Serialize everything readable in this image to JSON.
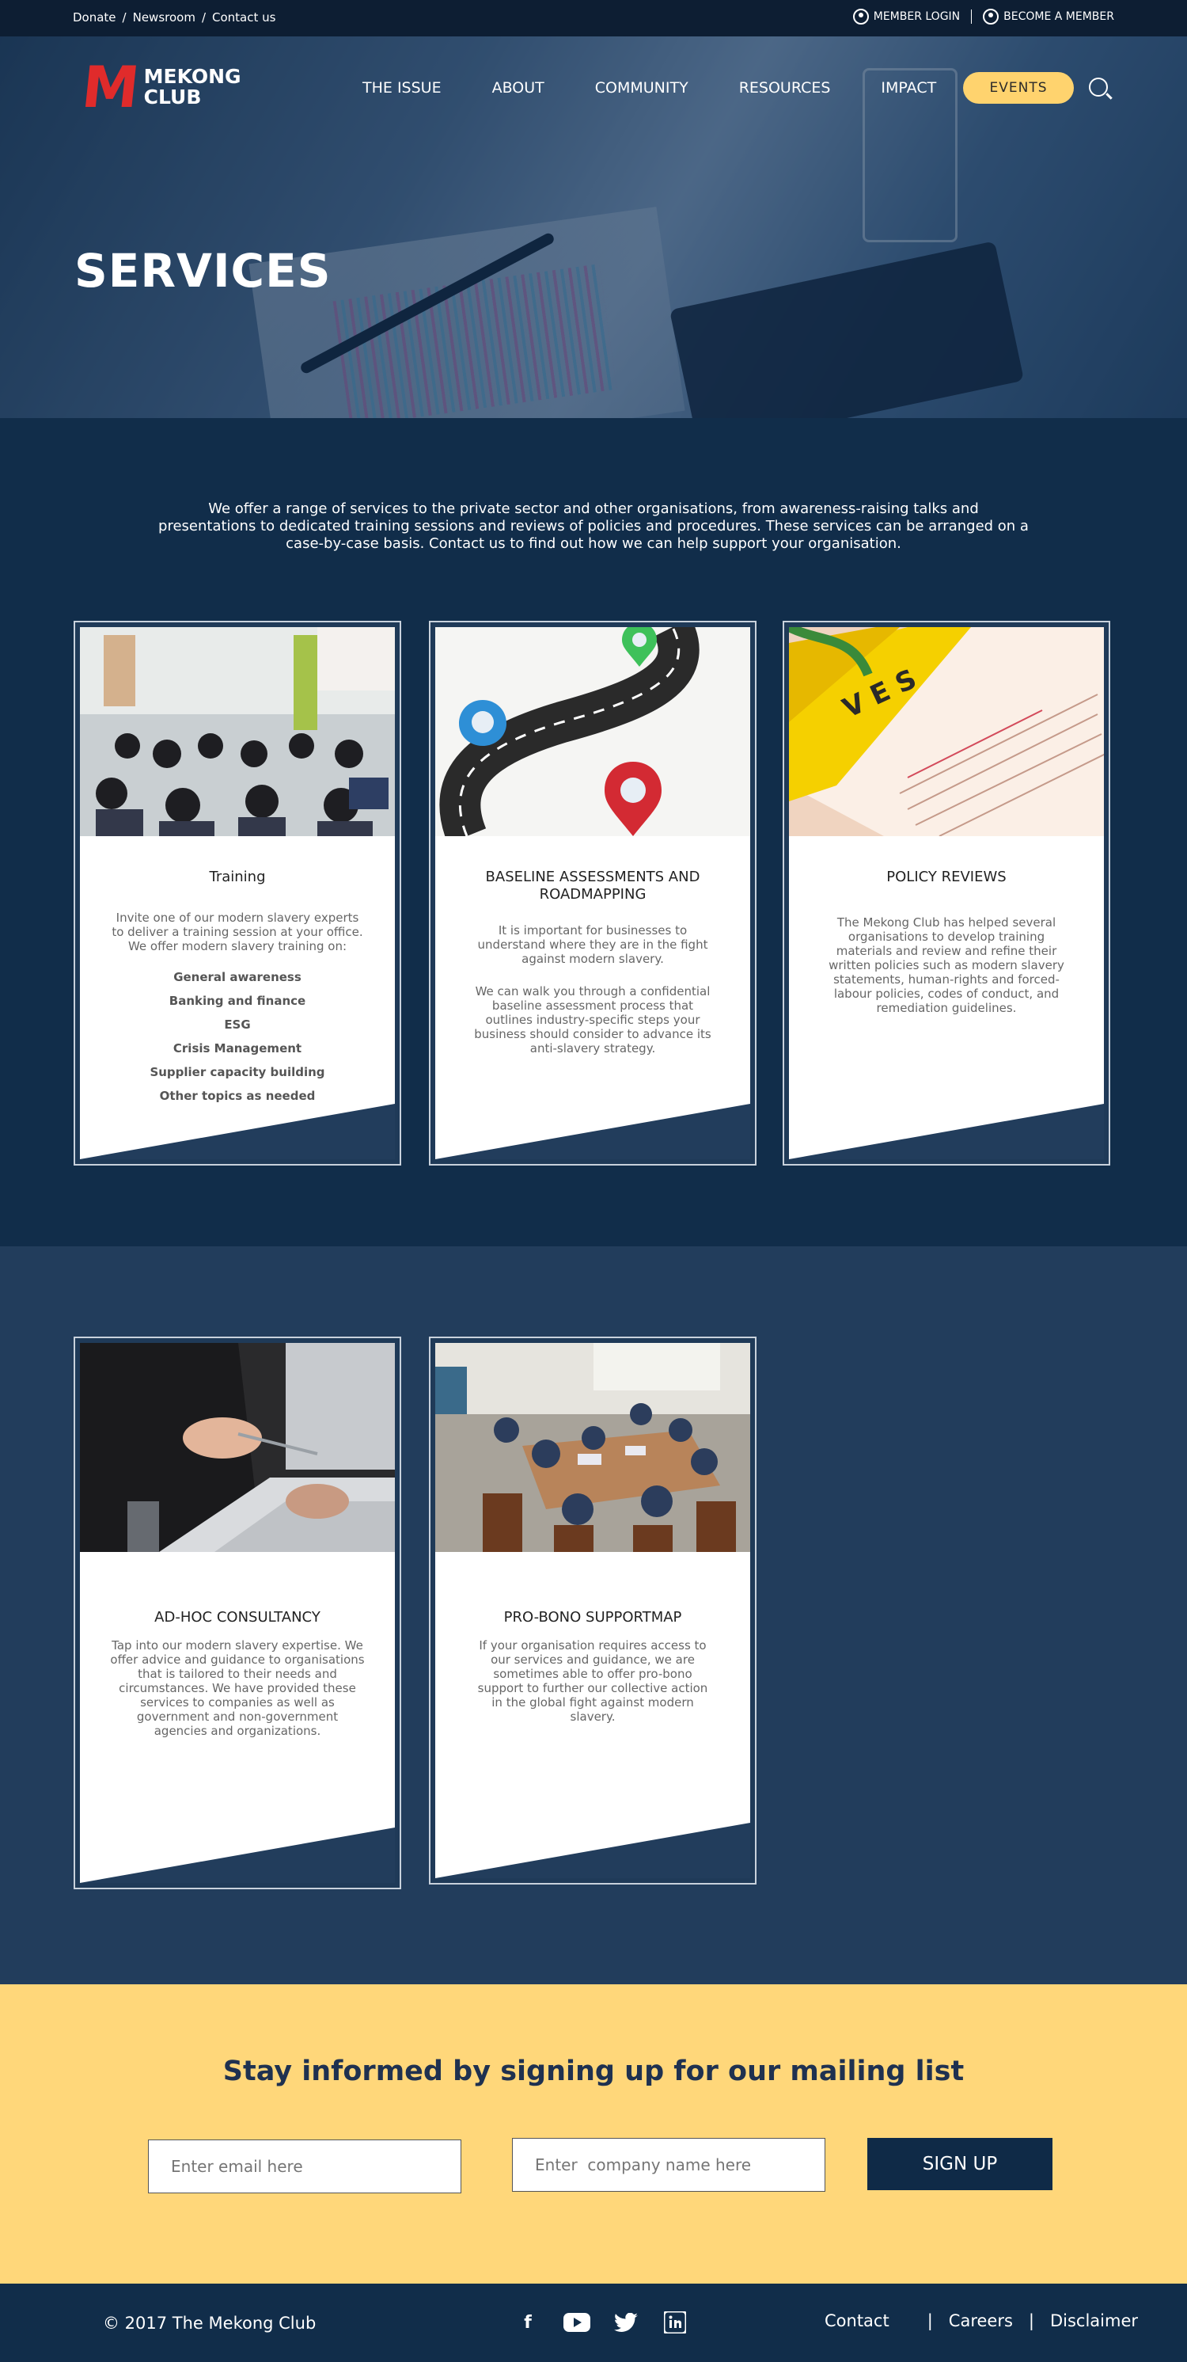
{
  "topbar": {
    "links": [
      "Donate",
      "Newsroom",
      "Contact us"
    ],
    "sep": "/",
    "member_login": "MEMBER  LOGIN",
    "become_member": "BECOME A MEMBER"
  },
  "logo": {
    "mark": "M",
    "line1": "MEKONG",
    "line2": "CLUB"
  },
  "nav": {
    "items": [
      "THE ISSUE",
      "ABOUT",
      "COMMUNITY",
      "RESOURCES",
      "IMPACT"
    ],
    "events": "EVENTS"
  },
  "hero": {
    "title": "SERVICES"
  },
  "intro": "We offer a range of services to the private sector and other organisations, from awareness-raising talks and presentations to dedicated training sessions and reviews of policies and procedures. These services can be arranged on a case-by-case basis. Contact us to find out how we can help support your organisation.",
  "cards": [
    {
      "title": "Training",
      "body": "Invite one of our modern slavery experts to deliver a training session at your office. We offer modern slavery training on:",
      "list": [
        "General awareness",
        "Banking and finance",
        "ESG",
        "Crisis Management",
        "Supplier capacity building",
        "Other topics as needed"
      ]
    },
    {
      "title": "BASELINE ASSESSMENTS AND ROADMAPPING",
      "body": "It is important for businesses to understand where they are in the fight against modern slavery.",
      "body2": "We can walk you through a confidential baseline assessment process that outlines industry-specific steps your business should consider to advance its anti-slavery strategy."
    },
    {
      "title": "POLICY REVIEWS",
      "body": "The Mekong Club has helped several organisations to develop training materials and review and refine their written policies such as modern slavery statements, human-rights and forced-labour policies, codes of conduct, and remediation guidelines."
    },
    {
      "title": "AD-HOC CONSULTANCY",
      "body": "Tap into our modern slavery expertise. We offer advice and guidance to organisations that is tailored to their needs and circumstances. We have provided these services to companies as well as government and non-government agencies and organizations."
    },
    {
      "title": "PRO-BONO SUPPORTMAP",
      "body": "If your organisation requires access to our services and guidance, we are sometimes able to offer pro-bono support to further our collective action in the global fight against modern slavery."
    }
  ],
  "mailing": {
    "heading": "Stay informed by signing up for our mailing list",
    "email_placeholder": "Enter email here",
    "company_placeholder": "Enter  company name here",
    "button": "SIGN UP"
  },
  "footer": {
    "copyright": "© 2017 The Mekong Club",
    "links": [
      "Contact",
      "Careers",
      "Disclaimer"
    ],
    "sep": "|",
    "social": [
      "facebook-icon",
      "youtube-icon",
      "twitter-icon",
      "linkedin-icon"
    ]
  },
  "colors": {
    "navy": "#112d4a",
    "accent_yellow": "#ffd77a",
    "brand_red": "#e02b2b"
  }
}
